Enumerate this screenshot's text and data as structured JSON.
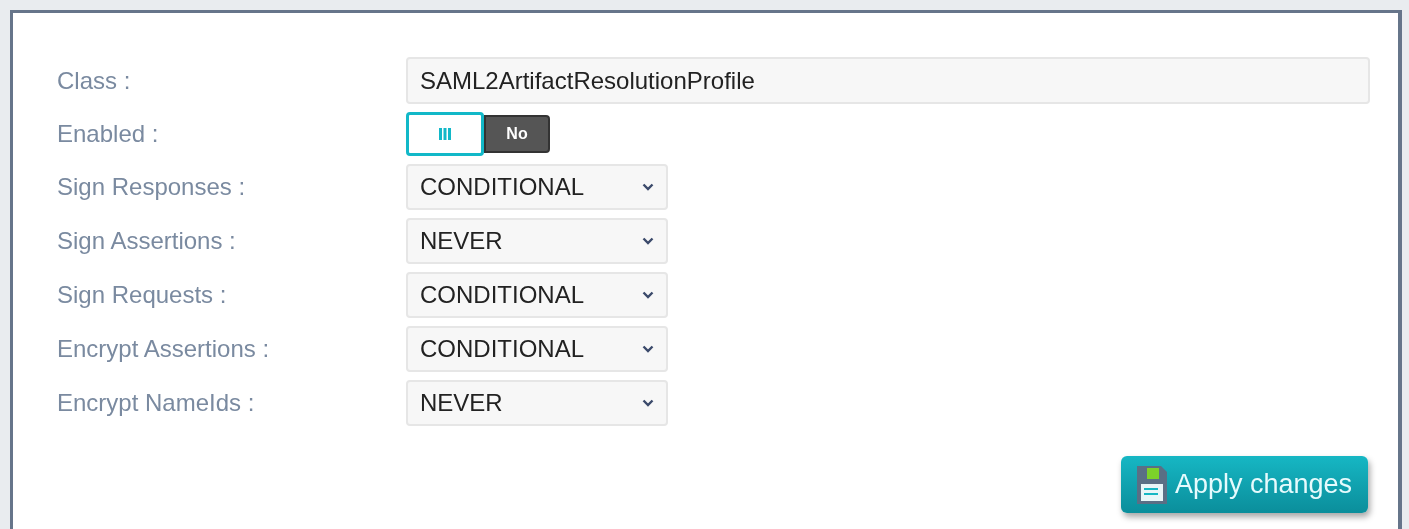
{
  "fields": [
    {
      "kind": "text",
      "label": "Class :",
      "value": "SAML2ArtifactResolutionProfile"
    },
    {
      "kind": "toggle",
      "label": "Enabled :",
      "on": false,
      "off_label": "No"
    },
    {
      "kind": "select",
      "label": "Sign Responses :",
      "value": "CONDITIONAL"
    },
    {
      "kind": "select",
      "label": "Sign Assertions :",
      "value": "NEVER"
    },
    {
      "kind": "select",
      "label": "Sign Requests :",
      "value": "CONDITIONAL"
    },
    {
      "kind": "select",
      "label": "Encrypt Assertions :",
      "value": "CONDITIONAL"
    },
    {
      "kind": "select",
      "label": "Encrypt NameIds :",
      "value": "NEVER"
    }
  ],
  "apply_button": "Apply changes"
}
